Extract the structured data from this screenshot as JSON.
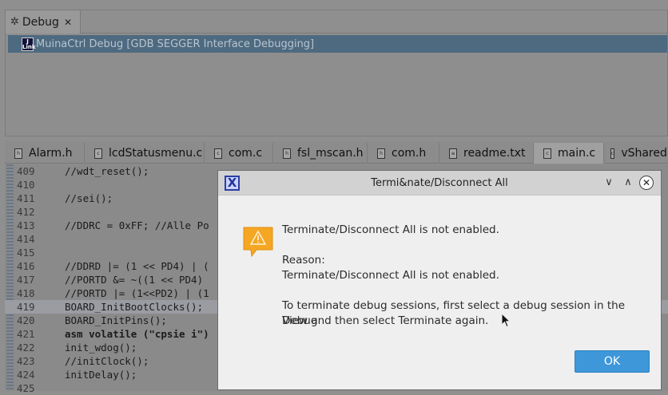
{
  "debug_view": {
    "tab_label": "Debug",
    "session_label": "MuinaCtrl Debug [GDB SEGGER Interface Debugging]",
    "jlink_icon_text": "J Link"
  },
  "editor": {
    "tabs": [
      {
        "label": "Alarm.h",
        "icon": "c-header-file-icon"
      },
      {
        "label": "lcdStatusmenu.c",
        "icon": "c-source-file-icon"
      },
      {
        "label": "com.c",
        "icon": "c-source-file-icon"
      },
      {
        "label": "fsl_mscan.h",
        "icon": "c-header-file-icon"
      },
      {
        "label": "com.h",
        "icon": "c-header-file-icon"
      },
      {
        "label": "readme.txt",
        "icon": "text-file-icon"
      },
      {
        "label": "main.c",
        "icon": "c-source-file-icon",
        "active": true
      },
      {
        "label": "vSharedD",
        "icon": "c-source-file-icon"
      }
    ],
    "lines": [
      {
        "num": "409",
        "code": "//wdt_reset();"
      },
      {
        "num": "410",
        "code": ""
      },
      {
        "num": "411",
        "code": "//sei();"
      },
      {
        "num": "412",
        "code": ""
      },
      {
        "num": "413",
        "code": "//DDRC = 0xFF; //Alle Po"
      },
      {
        "num": "414",
        "code": ""
      },
      {
        "num": "415",
        "code": ""
      },
      {
        "num": "416",
        "code": "//DDRD |= (1 << PD4) | ("
      },
      {
        "num": "417",
        "code": "//PORTD &= ~((1 << PD4)"
      },
      {
        "num": "418",
        "code": "//PORTD |= (1<<PD2) | (1"
      },
      {
        "num": "419",
        "code": "BOARD_InitBootClocks();"
      },
      {
        "num": "420",
        "code": "BOARD_InitPins();"
      },
      {
        "num": "421",
        "code": "asm volatile (\"cpsie i\")"
      },
      {
        "num": "422",
        "code": "init_wdog();"
      },
      {
        "num": "423",
        "code": "//initClock();"
      },
      {
        "num": "424",
        "code": "initDelay();"
      },
      {
        "num": "425",
        "code": ""
      }
    ]
  },
  "dialog": {
    "title": "Termi&nate/Disconnect All",
    "message": "Terminate/Disconnect All is not enabled.",
    "reason_label": "Reason:",
    "reason_text": "Terminate/Disconnect All is not enabled.",
    "instruction_line1": "To terminate debug sessions, first select a debug session in the Debug",
    "instruction_line2": "View and then select Terminate again.",
    "ok_label": "OK",
    "minimize_glyph": "∨",
    "maximize_glyph": "∧",
    "close_glyph": "✕",
    "app_icon_text": "X"
  },
  "colors": {
    "ok_button": "#3d97d9",
    "selected_session": "#4e6a80",
    "warning_icon": "#f5a623"
  }
}
